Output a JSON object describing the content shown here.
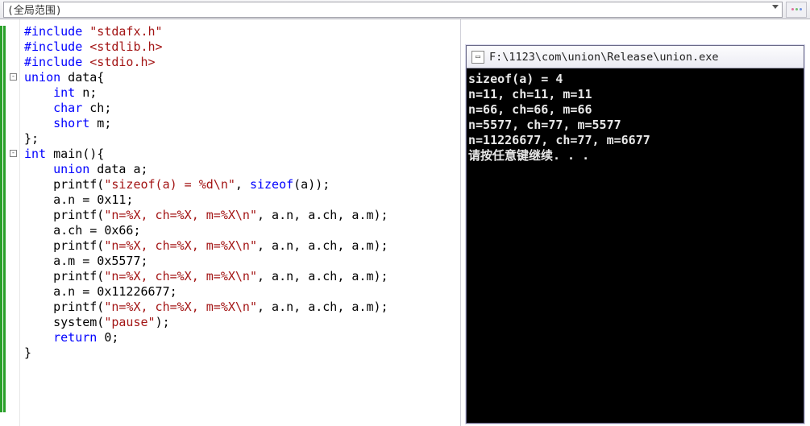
{
  "toolbar": {
    "scope_label": "(全局范围)"
  },
  "editor": {
    "lines": [
      [
        {
          "t": "#include ",
          "c": "pp"
        },
        {
          "t": "\"stdafx.h\"",
          "c": "str"
        }
      ],
      [
        {
          "t": "#include ",
          "c": "pp"
        },
        {
          "t": "<stdlib.h>",
          "c": "str"
        }
      ],
      [
        {
          "t": "#include ",
          "c": "pp"
        },
        {
          "t": "<stdio.h>",
          "c": "str"
        }
      ],
      [
        {
          "t": "union",
          "c": "kw"
        },
        {
          "t": " data{",
          "c": ""
        }
      ],
      [
        {
          "t": "    ",
          "c": ""
        },
        {
          "t": "int",
          "c": "kw"
        },
        {
          "t": " n;",
          "c": ""
        }
      ],
      [
        {
          "t": "    ",
          "c": ""
        },
        {
          "t": "char",
          "c": "kw"
        },
        {
          "t": " ch;",
          "c": ""
        }
      ],
      [
        {
          "t": "    ",
          "c": ""
        },
        {
          "t": "short",
          "c": "kw"
        },
        {
          "t": " m;",
          "c": ""
        }
      ],
      [
        {
          "t": "};",
          "c": ""
        }
      ],
      [
        {
          "t": "int",
          "c": "kw"
        },
        {
          "t": " main(){",
          "c": ""
        }
      ],
      [
        {
          "t": "    ",
          "c": ""
        },
        {
          "t": "union",
          "c": "kw"
        },
        {
          "t": " data a;",
          "c": ""
        }
      ],
      [
        {
          "t": "    printf(",
          "c": ""
        },
        {
          "t": "\"sizeof(a) = %d\\n\"",
          "c": "str"
        },
        {
          "t": ", ",
          "c": ""
        },
        {
          "t": "sizeof",
          "c": "kw"
        },
        {
          "t": "(a));",
          "c": ""
        }
      ],
      [
        {
          "t": "    a.n = 0x11;",
          "c": ""
        }
      ],
      [
        {
          "t": "    printf(",
          "c": ""
        },
        {
          "t": "\"n=%X, ch=%X, m=%X\\n\"",
          "c": "str"
        },
        {
          "t": ", a.n, a.ch, a.m);",
          "c": ""
        }
      ],
      [
        {
          "t": "    a.ch = 0x66;",
          "c": ""
        }
      ],
      [
        {
          "t": "    printf(",
          "c": ""
        },
        {
          "t": "\"n=%X, ch=%X, m=%X\\n\"",
          "c": "str"
        },
        {
          "t": ", a.n, a.ch, a.m);",
          "c": ""
        }
      ],
      [
        {
          "t": "    a.m = 0x5577;",
          "c": ""
        }
      ],
      [
        {
          "t": "    printf(",
          "c": ""
        },
        {
          "t": "\"n=%X, ch=%X, m=%X\\n\"",
          "c": "str"
        },
        {
          "t": ", a.n, a.ch, a.m);",
          "c": ""
        }
      ],
      [
        {
          "t": "    a.n = 0x11226677;",
          "c": ""
        }
      ],
      [
        {
          "t": "    printf(",
          "c": ""
        },
        {
          "t": "\"n=%X, ch=%X, m=%X\\n\"",
          "c": "str"
        },
        {
          "t": ", a.n, a.ch, a.m);",
          "c": ""
        }
      ],
      [
        {
          "t": "    system(",
          "c": ""
        },
        {
          "t": "\"pause\"",
          "c": "str"
        },
        {
          "t": ");",
          "c": ""
        }
      ],
      [
        {
          "t": "    ",
          "c": ""
        },
        {
          "t": "return",
          "c": "kw"
        },
        {
          "t": " 0;",
          "c": ""
        }
      ],
      [
        {
          "t": "}",
          "c": ""
        }
      ]
    ],
    "fold_markers": [
      3,
      8
    ]
  },
  "console": {
    "title": "F:\\1123\\com\\union\\Release\\union.exe",
    "lines": [
      "sizeof(a) = 4",
      "n=11, ch=11, m=11",
      "n=66, ch=66, m=66",
      "n=5577, ch=77, m=5577",
      "n=11226677, ch=77, m=6677",
      "请按任意键继续. . ."
    ]
  }
}
